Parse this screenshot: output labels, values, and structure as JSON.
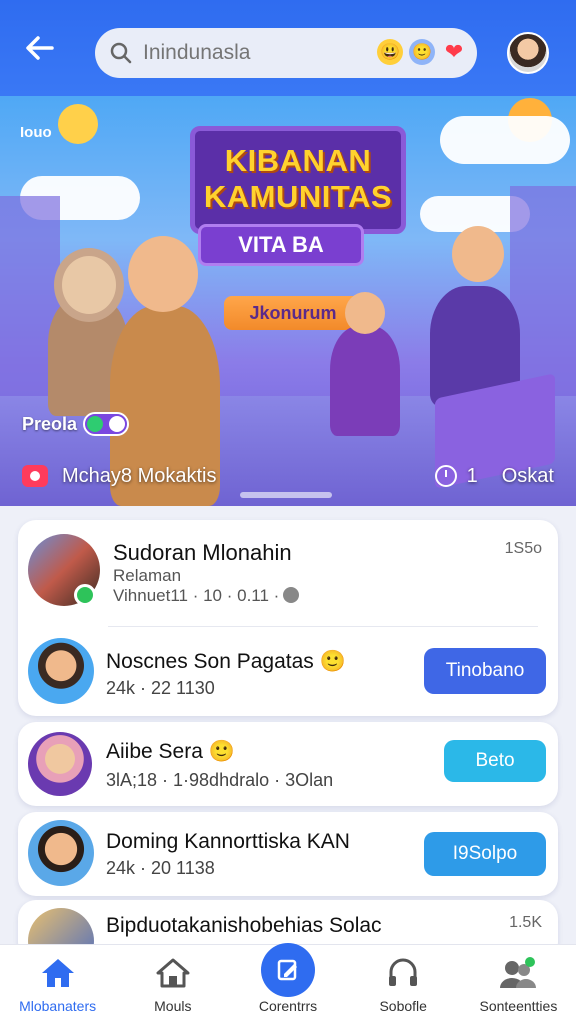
{
  "header": {
    "search_placeholder": "Inindunasla",
    "emojis": [
      "😃",
      "🙂",
      "❤"
    ]
  },
  "banner": {
    "title_line1": "KIBANAN",
    "title_line2": "KAMUNITAS",
    "subsign": "VITA BA",
    "pill": "Jkonurum",
    "top_left_label": "Iouo",
    "side_label": "Preola",
    "caption": "Mchay8 Mokaktis",
    "stat_count": "1",
    "stat_label": "Oskat"
  },
  "feed": {
    "post": {
      "name": "Sudoran Mlonahin",
      "role": "Relaman",
      "meta": "Vihnuet11 · 10 · 0.11 ·",
      "count": "1S5o"
    },
    "rows": [
      {
        "name": "Noscnes Son Pagatas 🙂",
        "meta": "24k · 22 1130",
        "button": "Tinobano"
      },
      {
        "name": "Aiibe Sera 🙂",
        "meta": "3lA;18 · 1·98dhdralo · 3Olan",
        "button": "Beto"
      },
      {
        "name": "Doming Kannorttiska KAN",
        "meta": "24k · 20 1138",
        "button": "I9Solpo"
      },
      {
        "name": "Bipduotakanishobehias Solac",
        "count": "1.5K"
      }
    ]
  },
  "nav": [
    {
      "label": "Mlobanaters",
      "icon": "home-icon",
      "active": true
    },
    {
      "label": "Mouls",
      "icon": "house-icon",
      "active": false
    },
    {
      "label": "Corentrrs",
      "icon": "edit-icon",
      "active": false
    },
    {
      "label": "Sobofle",
      "icon": "headphones-icon",
      "active": false
    },
    {
      "label": "Sonteentties",
      "icon": "people-icon",
      "active": false
    }
  ],
  "colors": {
    "primary": "#2f6cf0",
    "accent_blue": "#3f67e6",
    "accent_cyan": "#2bb8e8"
  }
}
